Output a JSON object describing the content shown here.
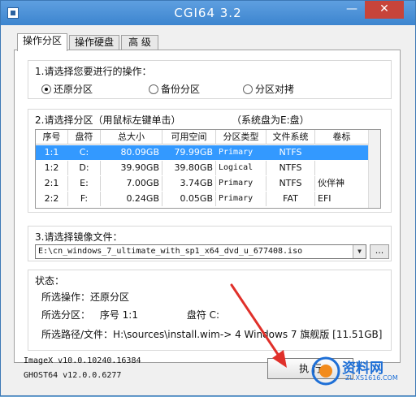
{
  "window": {
    "title": "CGI64  3.2",
    "minimize_glyph": "—",
    "close_glyph": "✕"
  },
  "tabs": [
    {
      "label": "操作分区",
      "active": true
    },
    {
      "label": "操作硬盘",
      "active": false
    },
    {
      "label": "高  级",
      "active": false
    }
  ],
  "step1": {
    "label": "1.请选择您要进行的操作：",
    "options": [
      {
        "label": "还原分区",
        "checked": true
      },
      {
        "label": "备份分区",
        "checked": false
      },
      {
        "label": "分区对拷",
        "checked": false
      }
    ]
  },
  "step2": {
    "label": "2.请选择分区（用鼠标左键单击）",
    "hint": "（系统盘为E:盘）",
    "columns": [
      "序号",
      "盘符",
      "总大小",
      "可用空间",
      "分区类型",
      "文件系统",
      "卷标"
    ],
    "rows": [
      {
        "num": "1:1",
        "drive": "C:",
        "total": "80.09GB",
        "free": "79.99GB",
        "type": "Primary",
        "fs": "NTFS",
        "label": "",
        "selected": true
      },
      {
        "num": "1:2",
        "drive": "D:",
        "total": "39.90GB",
        "free": "39.80GB",
        "type": "Logical",
        "fs": "NTFS",
        "label": "",
        "selected": false
      },
      {
        "num": "2:1",
        "drive": "E:",
        "total": "7.00GB",
        "free": "3.74GB",
        "type": "Primary",
        "fs": "NTFS",
        "label": "伙伴神",
        "selected": false
      },
      {
        "num": "2:2",
        "drive": "F:",
        "total": "0.24GB",
        "free": "0.05GB",
        "type": "Primary",
        "fs": "FAT",
        "label": "EFI",
        "selected": false
      }
    ]
  },
  "step3": {
    "label": "3.请选择镜像文件：",
    "image_path": "E:\\cn_windows_7_ultimate_with_sp1_x64_dvd_u_677408.iso",
    "browse_label": "..."
  },
  "status": {
    "label": "状态：",
    "operation": "所选操作：还原分区",
    "partition_prefix": "所选分区：",
    "partition_num": "序号 1:1",
    "partition_drive": "盘符 C:",
    "path": "所选路径/文件：H:\\sources\\install.wim-> 4  Windows 7 旗舰版 [11.51GB]"
  },
  "versions": {
    "imagex": "ImageX v10.0.10240.16384",
    "ghost": "GHOST64 v12.0.0.6277"
  },
  "execute_label": "执 行",
  "watermark": {
    "text": "资料网",
    "url": "ZL.XS1616.COM"
  }
}
